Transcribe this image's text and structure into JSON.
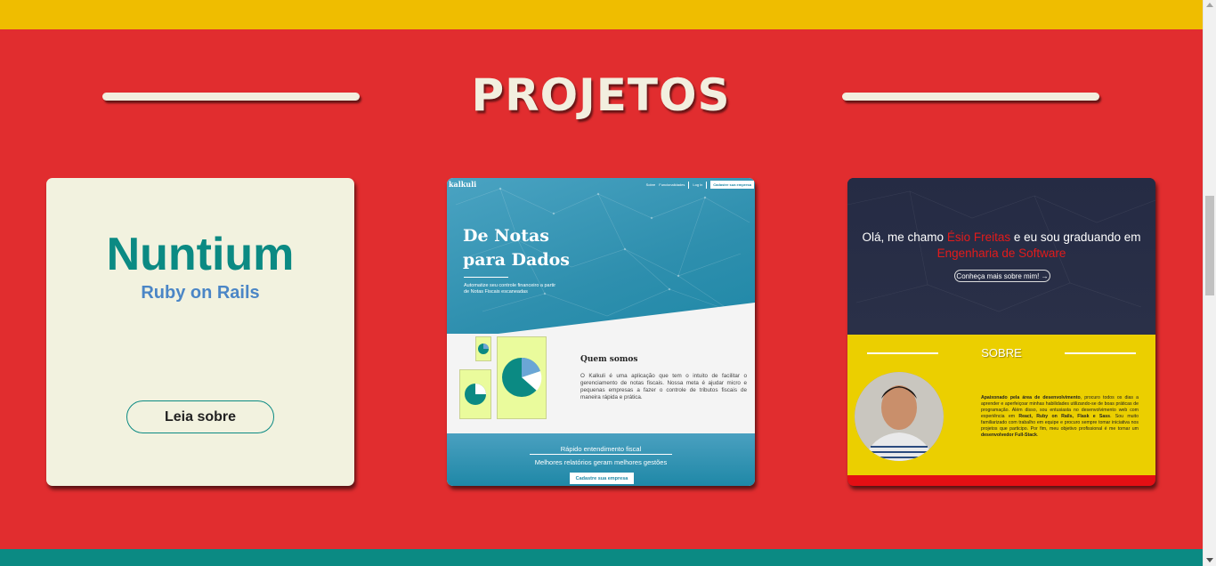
{
  "colors": {
    "top_band": "#efbd00",
    "section_bg": "#e12d2f",
    "bottom_band": "#0b8a83",
    "cream": "#f2efdf",
    "teal": "#0b8a83",
    "blue": "#4b86c6"
  },
  "section": {
    "title": "PROJETOS"
  },
  "projects": [
    {
      "title": "Nuntium",
      "tech": "Ruby on Rails",
      "button": "Leia sobre"
    },
    {
      "preview": {
        "logo": "kalkuli",
        "nav": [
          "Sobre",
          "Funcionalidades",
          "Log in"
        ],
        "nav_cta": "Cadastre sua empresa",
        "hero_title": "De Notas\npara Dados",
        "hero_sub": "Automatize seu controle financeiro a partir de Notas Fiscais escaneadas",
        "about_title": "Quem somos",
        "about_text": "O Kalkuli é uma aplicação que tem o intuito de facilitar o gerenciamento de notas fiscais. Nossa meta é ajudar micro e pequenas empresas a fazer o controle de tributos fiscais de maneira rápida e prática.",
        "footer_title": "Rápido entendimento fiscal",
        "footer_sub": "Melhores relatórios geram melhores gestões",
        "footer_button": "Cadastre sua empresa"
      }
    },
    {
      "preview": {
        "greeting_1": "Olá, me chamo ",
        "name": "Ésio Freitas",
        "greeting_2": " e eu sou graduando em ",
        "course": "Engenharia de Software",
        "more_button": "Conheça mais sobre mim! →",
        "about_title": "SOBRE",
        "about_p1_bold": "Apaixonado pela área de desenvolvimento",
        "about_p1": ", procuro todos os dias a aprender e aperfeiçoar minhas habilidades utilizando-se de boas práticas de programação. Além disso, sou entusiasta no desenvolvimento web com experiência em ",
        "about_p2_bold": "React, Ruby on Rails, Flask e Sass",
        "about_p2": ". Sou muito familiarizado com trabalho em equipe e procuro sempre tomar iniciativa nos projetos que participo. Por fim, meu objetivo profissional é me tornar um ",
        "about_p3_bold": "desenvolvedor Full-Stack",
        "about_p3": "."
      }
    }
  ]
}
